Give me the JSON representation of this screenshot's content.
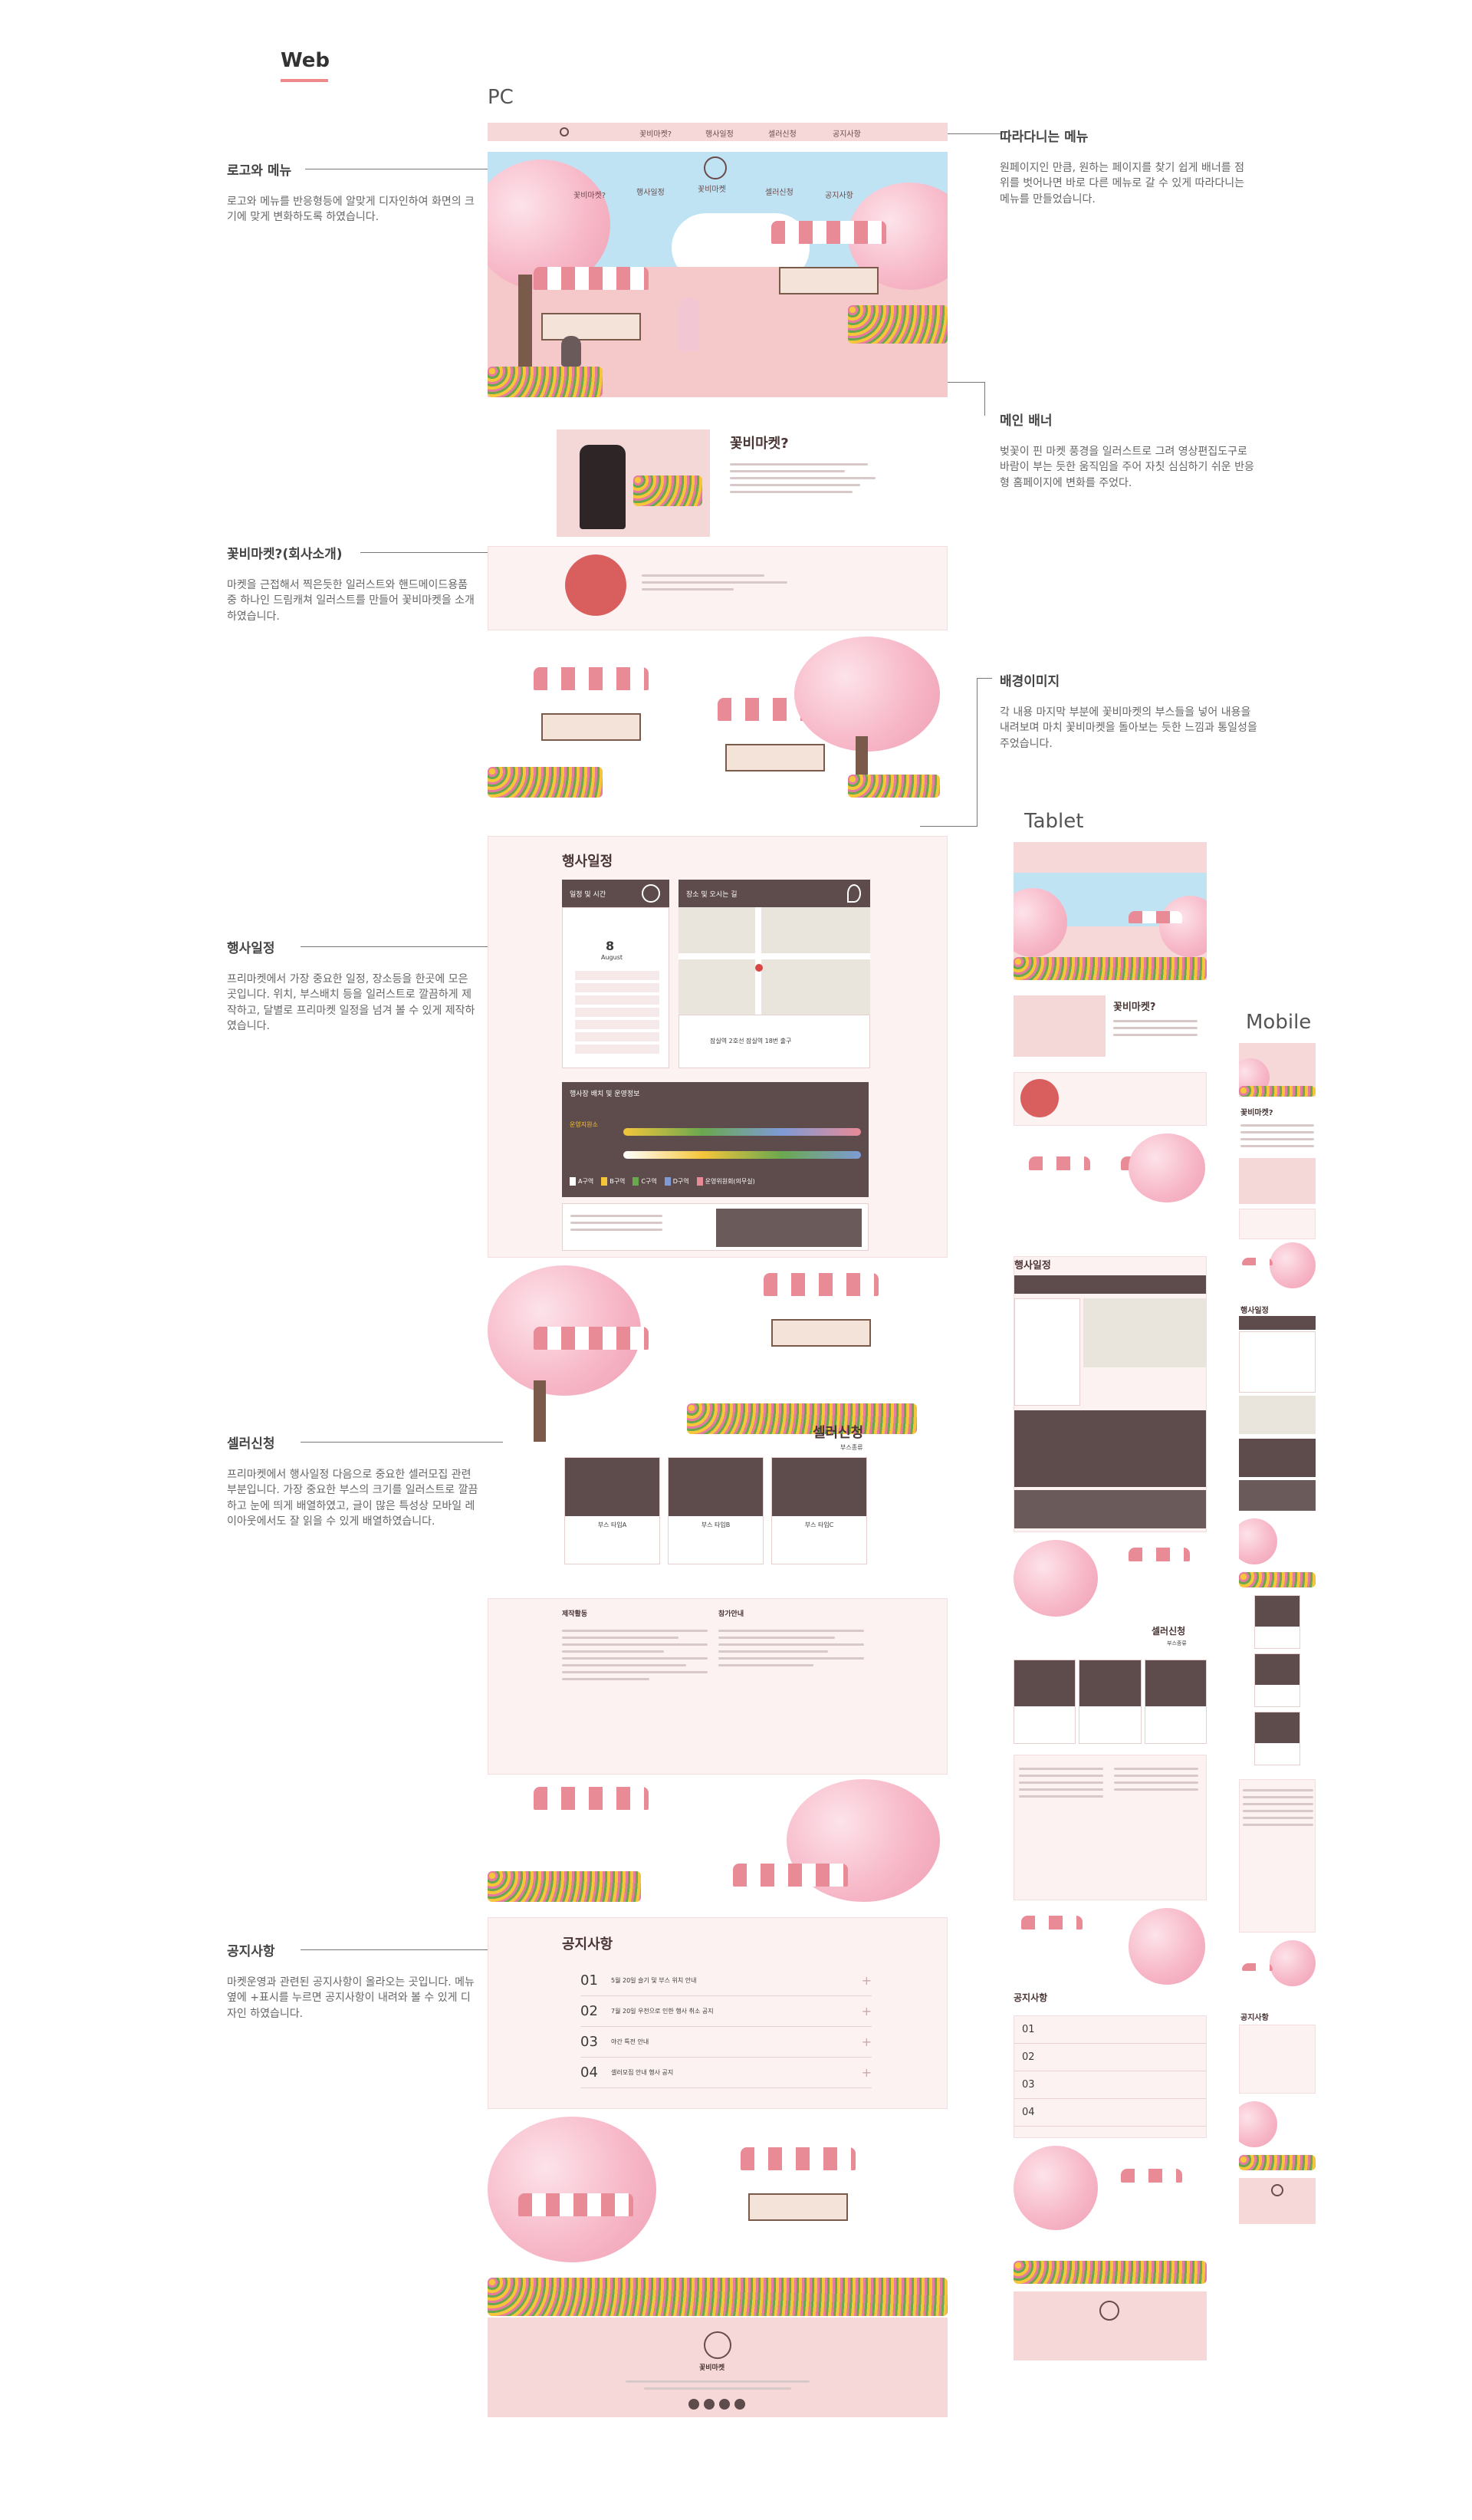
{
  "header": {
    "web_label": "Web"
  },
  "devices": {
    "pc": "PC",
    "tablet": "Tablet",
    "mobile": "Mobile"
  },
  "annotations": [
    {
      "title": "로고와 메뉴",
      "body": "로고와 메뉴를 반응형등에 알맞게 디자인하여 화면의 크기에 맞게 변화하도록 하였습니다."
    },
    {
      "title": "꽃비마켓?(회사소개)",
      "body": "마켓을 근접해서 찍은듯한 일러스트와 핸드메이드용품 중 하나인 드림캐쳐 일러스트를 만들어 꽃비마켓을 소개하였습니다."
    },
    {
      "title": "행사일정",
      "body": "프리마켓에서 가장 중요한 일정, 장소등을 한곳에 모은 곳입니다. 위치, 부스배치 등을 일러스트로 깔끔하게 제작하고, 달별로 프리마켓 일정을 넘겨 볼 수 있게 제작하였습니다."
    },
    {
      "title": "셀러신청",
      "body": "프리마켓에서 행사일정 다음으로 중요한 셀러모집 관련 부분입니다. 가장 중요한 부스의 크기를 일러스트로 깔끔하고 눈에 띄게 배열하였고, 글이 많은 특성상 모바일 레이아웃에서도 잘 읽을 수 있게 배열하였습니다."
    },
    {
      "title": "공지사항",
      "body": "마켓운영과 관련된 공지사항이 올라오는 곳입니다. 메뉴 옆에 +표시를 누르면 공지사항이 내려와 볼 수 있게 디자인 하였습니다."
    },
    {
      "title": "따라다니는 메뉴",
      "body": "원페이지인 만큼, 원하는 페이지를 찾기 쉽게 배너를 점위를 벗어나면 바로 다른 메뉴로 갈 수 있게 따라다니는 메뉴를 만들었습니다."
    },
    {
      "title": "메인 배너",
      "body": "벚꽃이 핀 마켓 풍경을 일러스트로 그려 영상편집도구로 바람이 부는 듯한 움직임을 주어 자칫 심심하기 쉬운 반응형 홈페이지에 변화를 주었다."
    },
    {
      "title": "배경이미지",
      "body": "각 내용 마지막 부분에 꽃비마켓의 부스들을 넣어 내용을 내려보며 마치 꽃비마켓을 돌아보는 듯한 느낌과 통일성을 주었습니다."
    }
  ],
  "pc": {
    "nav": [
      "꽃비마켓?",
      "행사일정",
      "셀러신청",
      "공지사항"
    ],
    "banner_nav": [
      "꽃비마켓?",
      "행사일정",
      "꽃비마켓",
      "셀러신청",
      "공지사항"
    ],
    "about_title": "꽃비마켓?",
    "schedule_title": "행사일정",
    "schedule_box1": "일정 및 시간",
    "schedule_box2": "장소 및 오시는 길",
    "calendar_month": "8",
    "calendar_month_en": "August",
    "map_caption": "잠실역 2호선 잠실역 18번 출구",
    "booth_title": "행사장 배치 및 운영정보",
    "booth_label": "운영지원소",
    "legend": [
      "A구역",
      "B구역",
      "C구역",
      "D구역",
      "운영위원회(의무실)"
    ],
    "legend_colors": [
      "#ffffff",
      "#f5c53a",
      "#6aa84f",
      "#7e9bd6",
      "#e98b97"
    ],
    "seller_title": "셀러신청",
    "seller_sub": "부스종류",
    "seller_cards": [
      "부스 타입A",
      "부스 타입B",
      "부스 타입C"
    ],
    "apply_cols": [
      "제작활동",
      "참가안내"
    ],
    "notice_title": "공지사항",
    "notices": [
      {
        "num": "01",
        "text": "5월 20일 슬기 및 부스 위치 안내"
      },
      {
        "num": "02",
        "text": "7월 20일 우천으로 인한 행사 취소 공지"
      },
      {
        "num": "03",
        "text": "야간 특전 안내"
      },
      {
        "num": "04",
        "text": "셀러모집 안내 행사 공지"
      }
    ],
    "footer_brand": "꽃비마켓"
  },
  "tablet": {
    "about_title": "꽃비마켓?",
    "schedule_title": "행사일정",
    "seller_title": "셀러신청",
    "seller_sub": "부스종류",
    "notice_title": "공지사항",
    "notices": [
      "01",
      "02",
      "03",
      "04"
    ]
  },
  "mobile": {
    "about_title": "꽃비마켓?",
    "schedule_title": "행사일정",
    "notice_title": "공지사항"
  },
  "colors": {
    "accent": "#f08a8a",
    "pink_bg": "#fdf2f2",
    "dark": "#5e4b4b"
  }
}
